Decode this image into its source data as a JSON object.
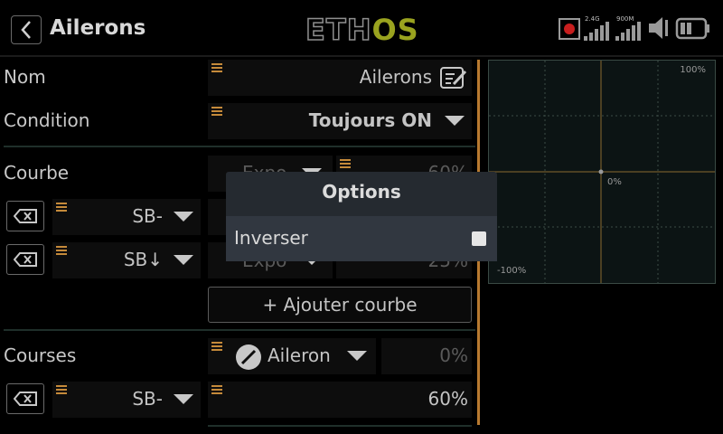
{
  "header": {
    "title": "Ailerons",
    "logo": "ETHOS",
    "logo_parts": [
      "ETH",
      "OS"
    ],
    "rf_label": "2.4G",
    "tel_label": "900M"
  },
  "form": {
    "name_label": "Nom",
    "name_value": "Ailerons",
    "condition_label": "Condition",
    "condition_value": "Toujours ON",
    "curve_label": "Courbe",
    "curve_row0_type": "Expo",
    "curve_row0_value": "60%",
    "curve_row1_switch": "SB-",
    "curve_row2_switch": "SB↓",
    "curve_row2_type": "Expo",
    "curve_row2_value": "25%",
    "add_curve_label": "+ Ajouter courbe",
    "rates_label": "Courses",
    "rates_source": "Aileron",
    "rates_offset": "0%",
    "rates_row_switch": "SB-",
    "rates_row_value": "60%"
  },
  "chart_data": {
    "type": "line",
    "labels": {
      "top_right": "100%",
      "center": "0%",
      "bottom_left": "-100%"
    },
    "grid": true,
    "xlim": [
      -100,
      100
    ],
    "ylim": [
      -100,
      100
    ]
  },
  "dialog": {
    "title": "Options",
    "option_label": "Inverser",
    "option_checked": false
  },
  "colors": {
    "accent": "#c58a3a",
    "logo_green": "#9aa31f",
    "dialog_bg": "#252a30"
  }
}
